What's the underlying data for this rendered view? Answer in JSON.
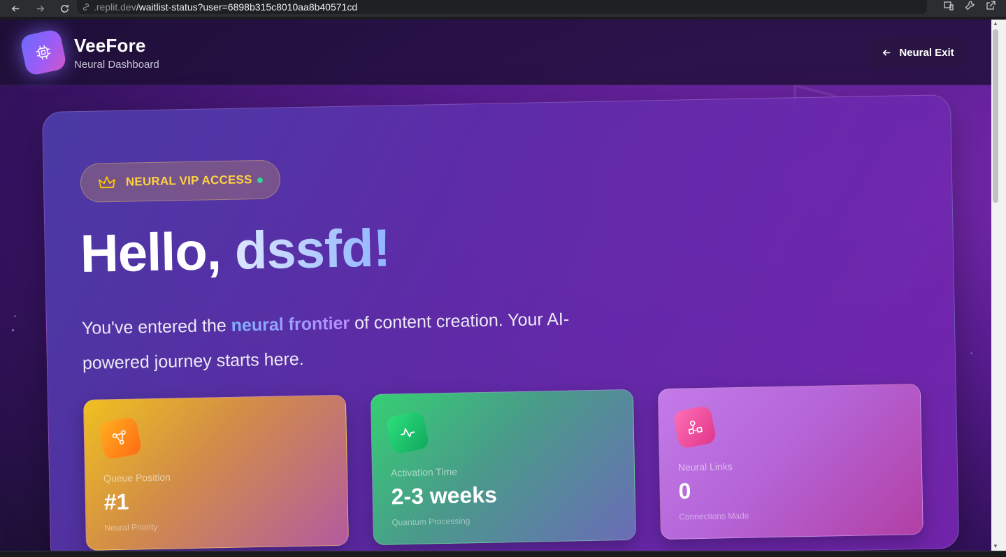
{
  "browser": {
    "url_host": ".replit.dev",
    "url_path": "/waitlist-status?user=6898b315c8010aa8b40571cd"
  },
  "header": {
    "brand_name": "VeeFore",
    "brand_subtitle": "Neural Dashboard",
    "exit_label": "Neural Exit"
  },
  "hero": {
    "badge_label": "NEURAL VIP ACCESS",
    "greeting_prefix": "Hello, ",
    "user_name": "dssfd!",
    "intro_before": "You've entered the ",
    "intro_highlight": "neural frontier",
    "intro_after": " of content creation. Your AI-powered journey starts here."
  },
  "stats": [
    {
      "label": "Queue Position",
      "value": "#1",
      "sub": "Neural Priority",
      "icon": "network-node-icon"
    },
    {
      "label": "Activation Time",
      "value": "2-3 weeks",
      "sub": "Quantum Processing",
      "icon": "activity-pulse-icon"
    },
    {
      "label": "Neural Links",
      "value": "0",
      "sub": "Connections Made",
      "icon": "share-nodes-icon"
    }
  ],
  "colors": {
    "accent_gold": "#ffd23f",
    "status_green": "#34d399",
    "background_purple": "#5a1d92"
  }
}
